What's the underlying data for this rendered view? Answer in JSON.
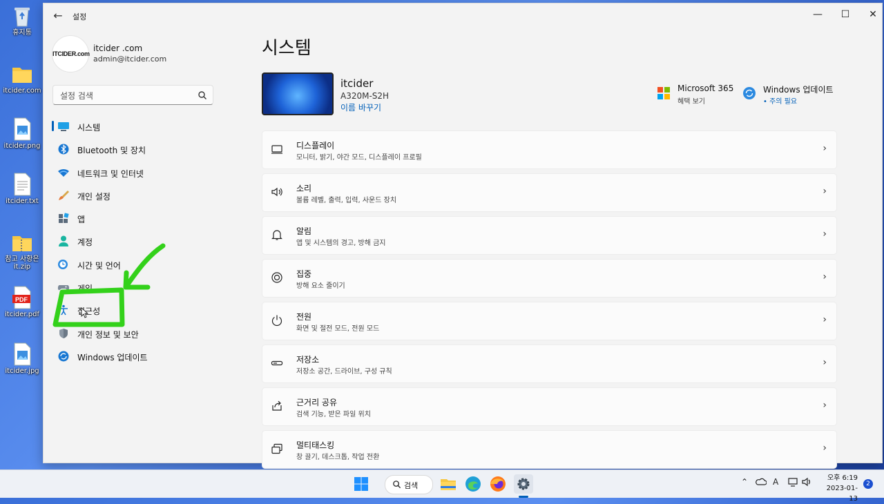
{
  "desktop": {
    "icons": [
      {
        "label": "휴지통",
        "icon": "recycle-bin-icon"
      },
      {
        "label": "itcider.com",
        "icon": "folder-icon"
      },
      {
        "label": "itcider.png",
        "icon": "image-file-icon"
      },
      {
        "label": "itcider.txt",
        "icon": "text-file-icon"
      },
      {
        "label": "참고 사항은 it.zip",
        "icon": "zip-folder-icon"
      },
      {
        "label": "itcider.pdf",
        "icon": "pdf-file-icon"
      },
      {
        "label": "itcider.jpg",
        "icon": "image-file-icon"
      }
    ]
  },
  "window": {
    "title": "설정",
    "controls": {
      "minimize": "—",
      "maximize": "☐",
      "close": "✕"
    }
  },
  "profile": {
    "avatar_text": "ITCIDER.com",
    "name": "itcider .com",
    "email": "admin@itcider.com"
  },
  "search": {
    "placeholder": "설정 검색"
  },
  "nav": {
    "items": [
      {
        "label": "시스템",
        "icon": "system-icon",
        "selected": true
      },
      {
        "label": "Bluetooth 및 장치",
        "icon": "bluetooth-icon"
      },
      {
        "label": "네트워크 및 인터넷",
        "icon": "wifi-icon"
      },
      {
        "label": "개인 설정",
        "icon": "brush-icon"
      },
      {
        "label": "앱",
        "icon": "apps-icon"
      },
      {
        "label": "계정",
        "icon": "account-icon"
      },
      {
        "label": "시간 및 언어",
        "icon": "clock-globe-icon"
      },
      {
        "label": "게임",
        "icon": "gamepad-icon"
      },
      {
        "label": "접근성",
        "icon": "accessibility-icon"
      },
      {
        "label": "개인 정보 및 보안",
        "icon": "shield-icon"
      },
      {
        "label": "Windows 업데이트",
        "icon": "update-icon"
      }
    ]
  },
  "main": {
    "title": "시스템",
    "device": {
      "name": "itcider",
      "model": "A320M-S2H",
      "rename": "이름 바꾸기"
    },
    "promos": [
      {
        "title": "Microsoft 365",
        "subtitle": "혜택 보기",
        "icon": "microsoft-logo-icon"
      },
      {
        "title": "Windows 업데이트",
        "subtitle": "• 주의 필요",
        "icon": "update-icon"
      }
    ],
    "cards": [
      {
        "title": "디스플레이",
        "subtitle": "모니터, 밝기, 야간 모드, 디스플레이 프로필",
        "icon": "display-icon"
      },
      {
        "title": "소리",
        "subtitle": "볼륨 레벨, 출력, 입력, 사운드 장치",
        "icon": "speaker-icon"
      },
      {
        "title": "알림",
        "subtitle": "앱 및 시스템의 경고, 방해 금지",
        "icon": "bell-icon"
      },
      {
        "title": "집중",
        "subtitle": "방해 요소 줄이기",
        "icon": "focus-icon"
      },
      {
        "title": "전원",
        "subtitle": "화면 및 절전 모드, 전원 모드",
        "icon": "power-icon"
      },
      {
        "title": "저장소",
        "subtitle": "저장소 공간, 드라이브, 구성 규칙",
        "icon": "storage-icon"
      },
      {
        "title": "근거리 공유",
        "subtitle": "검색 기능, 받은 파일 위치",
        "icon": "share-icon"
      },
      {
        "title": "멀티태스킹",
        "subtitle": "창 끌기, 데스크톱, 작업 전환",
        "icon": "multitask-icon"
      }
    ]
  },
  "taskbar": {
    "search_label": "검색",
    "tray_ime": "A",
    "time": "오후 6:19",
    "date": "2023-01-13",
    "notification_count": "2"
  },
  "colors": {
    "accent": "#005fb8",
    "annotation": "#33d11a"
  }
}
